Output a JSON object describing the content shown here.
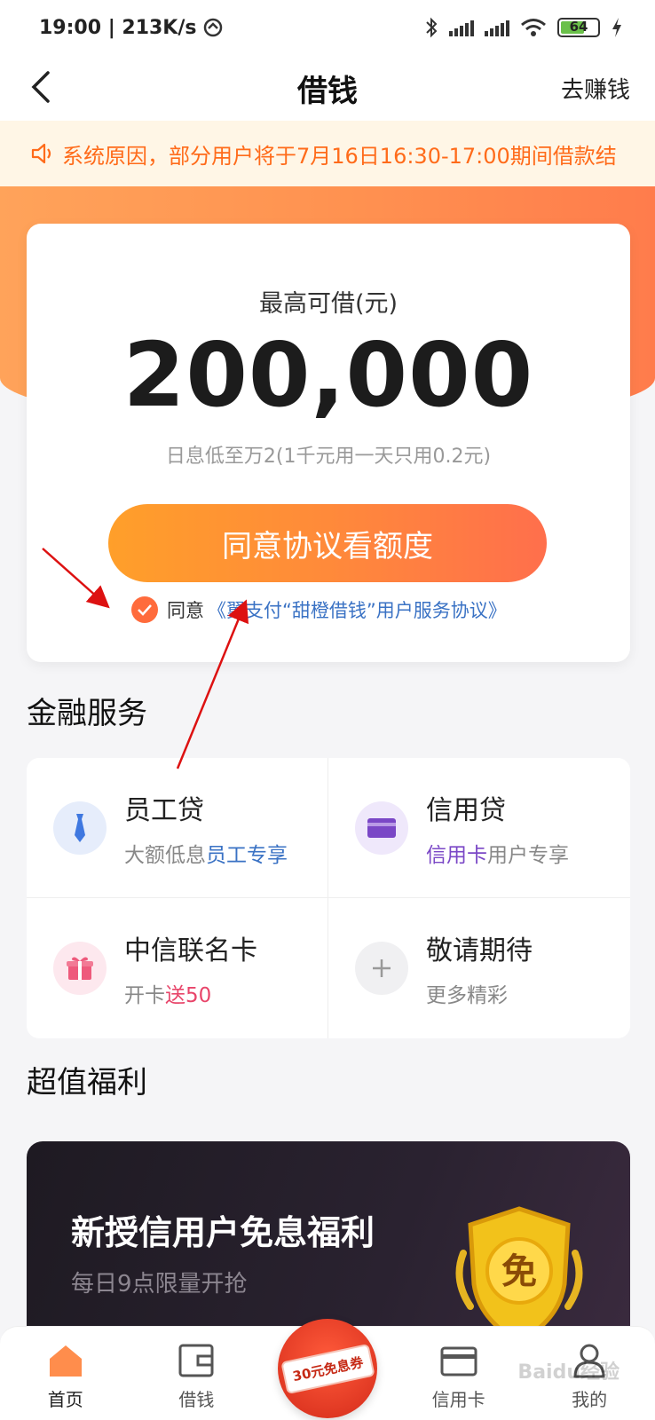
{
  "status_bar": {
    "time_speed": "19:00 | 213K/s",
    "battery_level": "64"
  },
  "header": {
    "title": "借钱",
    "earn_label": "去赚钱"
  },
  "notice": {
    "text": "系统原因，部分用户将于7月16日16:30-17:00期间借款结"
  },
  "loan_card": {
    "label": "最高可借(元)",
    "amount": "200,000",
    "rate_note": "日息低至万2(1千元用一天只用0.2元)",
    "cta_label": "同意协议看额度",
    "agree_text": "同意",
    "agreement_link": "《翼支付“甜橙借钱”用户服务协议》"
  },
  "finance_section": {
    "title": "金融服务",
    "items": [
      {
        "name": "员工贷",
        "sub_prefix": "大额低息",
        "sub_highlight": "员工专享",
        "sub_suffix": "",
        "icon": "tie-icon"
      },
      {
        "name": "信用贷",
        "sub_prefix": "",
        "sub_highlight": "信用卡",
        "sub_suffix": "用户专享",
        "icon": "card-icon"
      },
      {
        "name": "中信联名卡",
        "sub_prefix": "开卡",
        "sub_highlight": "送50",
        "sub_suffix": "",
        "icon": "gift-icon"
      },
      {
        "name": "敬请期待",
        "sub_prefix": "更多精彩",
        "sub_highlight": "",
        "sub_suffix": "",
        "icon": "plus-icon"
      }
    ]
  },
  "benefits_section": {
    "title": "超值福利",
    "promo_title": "新授信用户免息福利",
    "promo_sub": "每日9点限量开抢",
    "badge_char": "免"
  },
  "tab_bar": {
    "tabs": [
      {
        "label": "首页",
        "icon": "home-icon",
        "active": true
      },
      {
        "label": "借钱",
        "icon": "wallet-icon",
        "active": false
      },
      {
        "label": "",
        "icon": "coupon-icon",
        "active": false
      },
      {
        "label": "信用卡",
        "icon": "credit-card-icon",
        "active": false
      },
      {
        "label": "我的",
        "icon": "user-icon",
        "active": false
      }
    ],
    "coupon_text": "30元免息券"
  },
  "watermark": "Baidu经验",
  "colors": {
    "accent_orange": "#ff8a3a",
    "link_blue": "#3a72c4",
    "notice_orange": "#ff6b1a"
  }
}
